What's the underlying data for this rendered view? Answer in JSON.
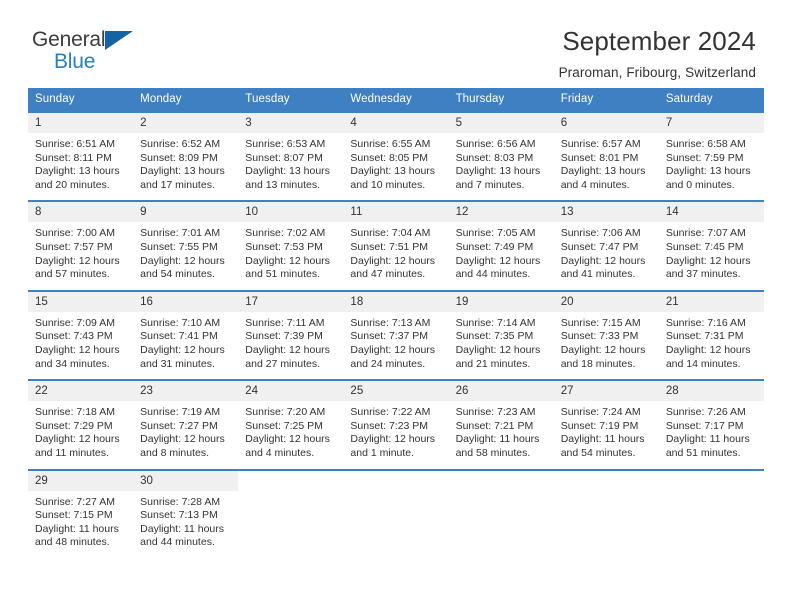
{
  "brand": {
    "name_part1": "General",
    "name_part2": "Blue",
    "triangle_color": "#1464a5",
    "blue_color": "#2580c3"
  },
  "header": {
    "title": "September 2024",
    "subtitle": "Praroman, Fribourg, Switzerland"
  },
  "theme": {
    "header_blue": "#3f80c2",
    "daynum_bg": "#f0f0f0",
    "text": "#333333"
  },
  "calendar": {
    "weekday_headers": [
      "Sunday",
      "Monday",
      "Tuesday",
      "Wednesday",
      "Thursday",
      "Friday",
      "Saturday"
    ],
    "weeks": [
      [
        {
          "day": "1",
          "sunrise": "Sunrise: 6:51 AM",
          "sunset": "Sunset: 8:11 PM",
          "daylight1": "Daylight: 13 hours",
          "daylight2": "and 20 minutes."
        },
        {
          "day": "2",
          "sunrise": "Sunrise: 6:52 AM",
          "sunset": "Sunset: 8:09 PM",
          "daylight1": "Daylight: 13 hours",
          "daylight2": "and 17 minutes."
        },
        {
          "day": "3",
          "sunrise": "Sunrise: 6:53 AM",
          "sunset": "Sunset: 8:07 PM",
          "daylight1": "Daylight: 13 hours",
          "daylight2": "and 13 minutes."
        },
        {
          "day": "4",
          "sunrise": "Sunrise: 6:55 AM",
          "sunset": "Sunset: 8:05 PM",
          "daylight1": "Daylight: 13 hours",
          "daylight2": "and 10 minutes."
        },
        {
          "day": "5",
          "sunrise": "Sunrise: 6:56 AM",
          "sunset": "Sunset: 8:03 PM",
          "daylight1": "Daylight: 13 hours",
          "daylight2": "and 7 minutes."
        },
        {
          "day": "6",
          "sunrise": "Sunrise: 6:57 AM",
          "sunset": "Sunset: 8:01 PM",
          "daylight1": "Daylight: 13 hours",
          "daylight2": "and 4 minutes."
        },
        {
          "day": "7",
          "sunrise": "Sunrise: 6:58 AM",
          "sunset": "Sunset: 7:59 PM",
          "daylight1": "Daylight: 13 hours",
          "daylight2": "and 0 minutes."
        }
      ],
      [
        {
          "day": "8",
          "sunrise": "Sunrise: 7:00 AM",
          "sunset": "Sunset: 7:57 PM",
          "daylight1": "Daylight: 12 hours",
          "daylight2": "and 57 minutes."
        },
        {
          "day": "9",
          "sunrise": "Sunrise: 7:01 AM",
          "sunset": "Sunset: 7:55 PM",
          "daylight1": "Daylight: 12 hours",
          "daylight2": "and 54 minutes."
        },
        {
          "day": "10",
          "sunrise": "Sunrise: 7:02 AM",
          "sunset": "Sunset: 7:53 PM",
          "daylight1": "Daylight: 12 hours",
          "daylight2": "and 51 minutes."
        },
        {
          "day": "11",
          "sunrise": "Sunrise: 7:04 AM",
          "sunset": "Sunset: 7:51 PM",
          "daylight1": "Daylight: 12 hours",
          "daylight2": "and 47 minutes."
        },
        {
          "day": "12",
          "sunrise": "Sunrise: 7:05 AM",
          "sunset": "Sunset: 7:49 PM",
          "daylight1": "Daylight: 12 hours",
          "daylight2": "and 44 minutes."
        },
        {
          "day": "13",
          "sunrise": "Sunrise: 7:06 AM",
          "sunset": "Sunset: 7:47 PM",
          "daylight1": "Daylight: 12 hours",
          "daylight2": "and 41 minutes."
        },
        {
          "day": "14",
          "sunrise": "Sunrise: 7:07 AM",
          "sunset": "Sunset: 7:45 PM",
          "daylight1": "Daylight: 12 hours",
          "daylight2": "and 37 minutes."
        }
      ],
      [
        {
          "day": "15",
          "sunrise": "Sunrise: 7:09 AM",
          "sunset": "Sunset: 7:43 PM",
          "daylight1": "Daylight: 12 hours",
          "daylight2": "and 34 minutes."
        },
        {
          "day": "16",
          "sunrise": "Sunrise: 7:10 AM",
          "sunset": "Sunset: 7:41 PM",
          "daylight1": "Daylight: 12 hours",
          "daylight2": "and 31 minutes."
        },
        {
          "day": "17",
          "sunrise": "Sunrise: 7:11 AM",
          "sunset": "Sunset: 7:39 PM",
          "daylight1": "Daylight: 12 hours",
          "daylight2": "and 27 minutes."
        },
        {
          "day": "18",
          "sunrise": "Sunrise: 7:13 AM",
          "sunset": "Sunset: 7:37 PM",
          "daylight1": "Daylight: 12 hours",
          "daylight2": "and 24 minutes."
        },
        {
          "day": "19",
          "sunrise": "Sunrise: 7:14 AM",
          "sunset": "Sunset: 7:35 PM",
          "daylight1": "Daylight: 12 hours",
          "daylight2": "and 21 minutes."
        },
        {
          "day": "20",
          "sunrise": "Sunrise: 7:15 AM",
          "sunset": "Sunset: 7:33 PM",
          "daylight1": "Daylight: 12 hours",
          "daylight2": "and 18 minutes."
        },
        {
          "day": "21",
          "sunrise": "Sunrise: 7:16 AM",
          "sunset": "Sunset: 7:31 PM",
          "daylight1": "Daylight: 12 hours",
          "daylight2": "and 14 minutes."
        }
      ],
      [
        {
          "day": "22",
          "sunrise": "Sunrise: 7:18 AM",
          "sunset": "Sunset: 7:29 PM",
          "daylight1": "Daylight: 12 hours",
          "daylight2": "and 11 minutes."
        },
        {
          "day": "23",
          "sunrise": "Sunrise: 7:19 AM",
          "sunset": "Sunset: 7:27 PM",
          "daylight1": "Daylight: 12 hours",
          "daylight2": "and 8 minutes."
        },
        {
          "day": "24",
          "sunrise": "Sunrise: 7:20 AM",
          "sunset": "Sunset: 7:25 PM",
          "daylight1": "Daylight: 12 hours",
          "daylight2": "and 4 minutes."
        },
        {
          "day": "25",
          "sunrise": "Sunrise: 7:22 AM",
          "sunset": "Sunset: 7:23 PM",
          "daylight1": "Daylight: 12 hours",
          "daylight2": "and 1 minute."
        },
        {
          "day": "26",
          "sunrise": "Sunrise: 7:23 AM",
          "sunset": "Sunset: 7:21 PM",
          "daylight1": "Daylight: 11 hours",
          "daylight2": "and 58 minutes."
        },
        {
          "day": "27",
          "sunrise": "Sunrise: 7:24 AM",
          "sunset": "Sunset: 7:19 PM",
          "daylight1": "Daylight: 11 hours",
          "daylight2": "and 54 minutes."
        },
        {
          "day": "28",
          "sunrise": "Sunrise: 7:26 AM",
          "sunset": "Sunset: 7:17 PM",
          "daylight1": "Daylight: 11 hours",
          "daylight2": "and 51 minutes."
        }
      ],
      [
        {
          "day": "29",
          "sunrise": "Sunrise: 7:27 AM",
          "sunset": "Sunset: 7:15 PM",
          "daylight1": "Daylight: 11 hours",
          "daylight2": "and 48 minutes."
        },
        {
          "day": "30",
          "sunrise": "Sunrise: 7:28 AM",
          "sunset": "Sunset: 7:13 PM",
          "daylight1": "Daylight: 11 hours",
          "daylight2": "and 44 minutes."
        },
        {
          "day": "",
          "sunrise": "",
          "sunset": "",
          "daylight1": "",
          "daylight2": ""
        },
        {
          "day": "",
          "sunrise": "",
          "sunset": "",
          "daylight1": "",
          "daylight2": ""
        },
        {
          "day": "",
          "sunrise": "",
          "sunset": "",
          "daylight1": "",
          "daylight2": ""
        },
        {
          "day": "",
          "sunrise": "",
          "sunset": "",
          "daylight1": "",
          "daylight2": ""
        },
        {
          "day": "",
          "sunrise": "",
          "sunset": "",
          "daylight1": "",
          "daylight2": ""
        }
      ]
    ]
  }
}
